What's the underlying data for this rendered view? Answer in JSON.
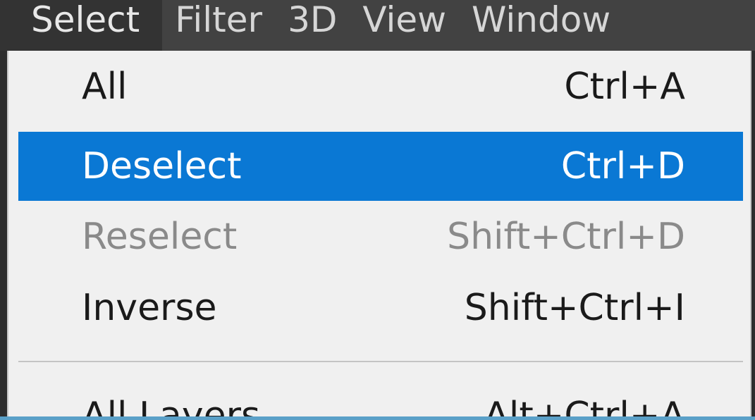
{
  "menubar": {
    "menus": [
      "Select",
      "Filter",
      "3D",
      "View",
      "Window"
    ]
  },
  "dropdown": {
    "items": [
      {
        "label": "All",
        "shortcut": "Ctrl+A"
      },
      {
        "label": "Deselect",
        "shortcut": "Ctrl+D"
      },
      {
        "label": "Reselect",
        "shortcut": "Shift+Ctrl+D"
      },
      {
        "label": "Inverse",
        "shortcut": "Shift+Ctrl+I"
      },
      {
        "label": "All Layers",
        "shortcut": "Alt+Ctrl+A"
      }
    ]
  },
  "colors": {
    "highlight": "#0a78d4",
    "menu_background": "#f0f0f0",
    "menubar_background": "#424242",
    "disabled_text": "#8a8a8a"
  }
}
